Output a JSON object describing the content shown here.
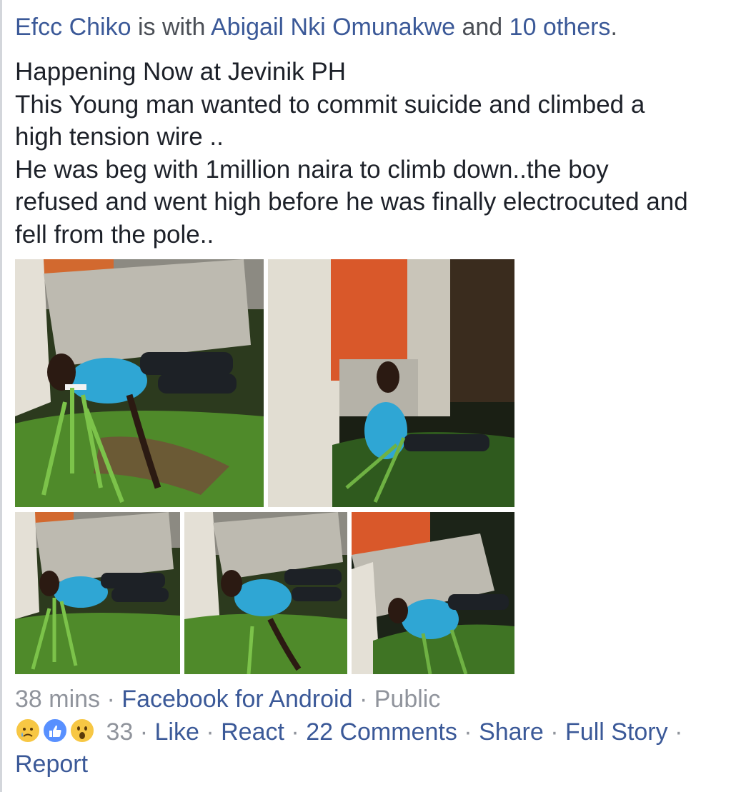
{
  "post": {
    "author": "Efcc Chiko",
    "with_word": "is with",
    "tagged_person": "Abigail Nki Omunakwe",
    "and_word": "and",
    "others": "10 others",
    "period": ".",
    "text_lines": [
      "Happening Now at Jevinik PH",
      "This Young man wanted to commit suicide and climbed a",
      "high tension wire ..",
      "He was beg with 1million naira to climb down..the boy",
      "refused and went high before he was finally electrocuted and",
      "fell from the pole.."
    ]
  },
  "photos": [
    {
      "name": "photo-1"
    },
    {
      "name": "photo-2"
    },
    {
      "name": "photo-3"
    },
    {
      "name": "photo-4"
    },
    {
      "name": "photo-5"
    }
  ],
  "meta": {
    "time": "38 mins",
    "source": "Facebook for Android",
    "privacy": "Public",
    "separator": "·"
  },
  "actions": {
    "reaction_icons": [
      "sad-reaction-icon",
      "like-reaction-icon",
      "wow-reaction-icon"
    ],
    "reaction_count": "33",
    "like": "Like",
    "react": "React",
    "comments": "22 Comments",
    "share": "Share",
    "full_story": "Full Story",
    "report": "Report"
  },
  "colors": {
    "link": "#3b5998",
    "meta": "#90949c",
    "like_blue": "#5890ff",
    "reaction_yellow": "#f7c744"
  }
}
